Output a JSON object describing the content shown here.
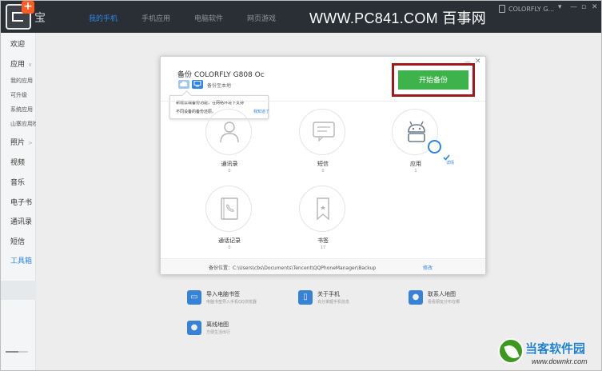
{
  "app": {
    "name": "宝",
    "nav_tabs": [
      "我的手机",
      "手机应用",
      "电脑软件",
      "网页游戏"
    ],
    "watermark": "WWW.PC841.COM 百事网",
    "device": "COLORFLY G..."
  },
  "sidebar": {
    "items": [
      {
        "label": "欢迎",
        "type": "cat"
      },
      {
        "label": "应用",
        "type": "cat",
        "arrow": "∨"
      },
      {
        "label": "我的应用",
        "type": "sub"
      },
      {
        "label": "可升级",
        "type": "sub"
      },
      {
        "label": "系统应用",
        "type": "sub"
      },
      {
        "label": "山寨应用检测",
        "type": "sub"
      },
      {
        "label": "照片",
        "type": "cat",
        "arrow": ">"
      },
      {
        "label": "视频",
        "type": "cat"
      },
      {
        "label": "音乐",
        "type": "cat"
      },
      {
        "label": "电子书",
        "type": "cat"
      },
      {
        "label": "通讯录",
        "type": "cat",
        "arrow": ">"
      },
      {
        "label": "短信",
        "type": "cat"
      },
      {
        "label": "工具箱",
        "type": "cat",
        "active": true
      }
    ]
  },
  "tools": [
    {
      "name": "导入电脑书签",
      "desc": "电脑书签导入手机QQ浏览器"
    },
    {
      "name": "关于手机",
      "desc": "充分掌握手机信息"
    },
    {
      "name": "联系人地图",
      "desc": "看看朋友分布在哪"
    },
    {
      "name": "离线地图",
      "desc": "方便生活出行"
    }
  ],
  "dialog": {
    "title": "备份 COLORFLY G808 Oc",
    "destination": "备份至本地",
    "start_button": "开始备份",
    "tooltip": {
      "line1": "新增云端备份功能，在网络环境下支持",
      "line2": "不同设备的备份还原。",
      "link": "我知道了"
    },
    "categories": [
      {
        "label": "通讯录",
        "count": "0",
        "icon": "contact-icon"
      },
      {
        "label": "短信",
        "count": "0",
        "icon": "sms-icon"
      },
      {
        "label": "应用",
        "count": "1",
        "icon": "android-icon",
        "detail": "详情",
        "checked": true
      },
      {
        "label": "通话记录",
        "count": "0",
        "icon": "call-log-icon"
      },
      {
        "label": "书签",
        "count": "17",
        "icon": "bookmark-icon"
      }
    ],
    "footer": {
      "path_label": "备份位置：C:\\Users\\cbs\\Documents\\Tencent\\QQPhoneManager\\Backup",
      "edit": "修改"
    }
  },
  "brand": {
    "name": "当客软件园",
    "url": "www.downkr.com"
  },
  "colors": {
    "accent": "#2e86e6",
    "start_button": "#3fb34b",
    "highlight_frame": "#a3161a",
    "titlebar": "#2a2f35"
  }
}
